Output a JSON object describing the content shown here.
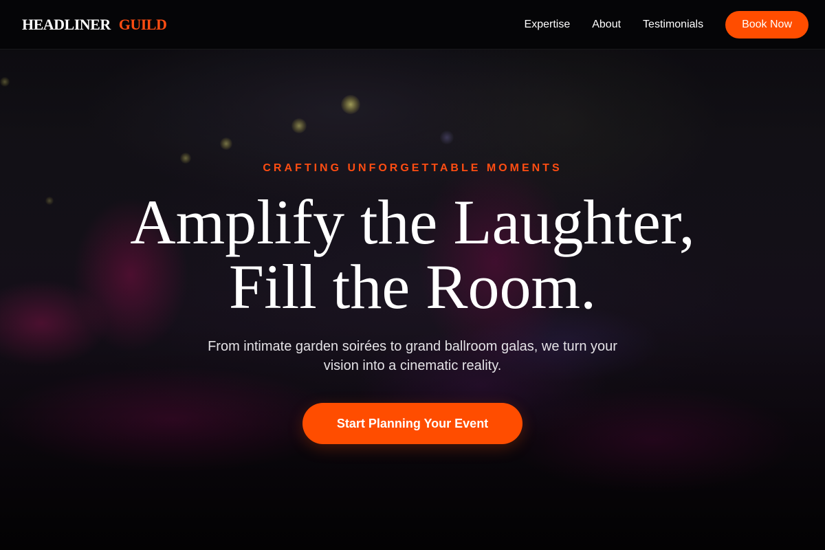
{
  "brand": {
    "name": "HEADLINER",
    "accent": "GUILD"
  },
  "nav": {
    "links": [
      "Expertise",
      "About",
      "Testimonials"
    ],
    "cta_label": "Book Now"
  },
  "hero": {
    "eyebrow": "CRAFTING UNFORGETTABLE MOMENTS",
    "headline_line1": "Amplify the Laughter,",
    "headline_line2": "Fill the Room.",
    "subtitle": "From intimate garden soirées to grand ballroom galas, we turn your vision into a cinematic reality.",
    "cta_label": "Start Planning Your Event"
  },
  "colors": {
    "accent": "#ff4d00",
    "navbar_bg": "#050507",
    "text": "#ffffff"
  }
}
